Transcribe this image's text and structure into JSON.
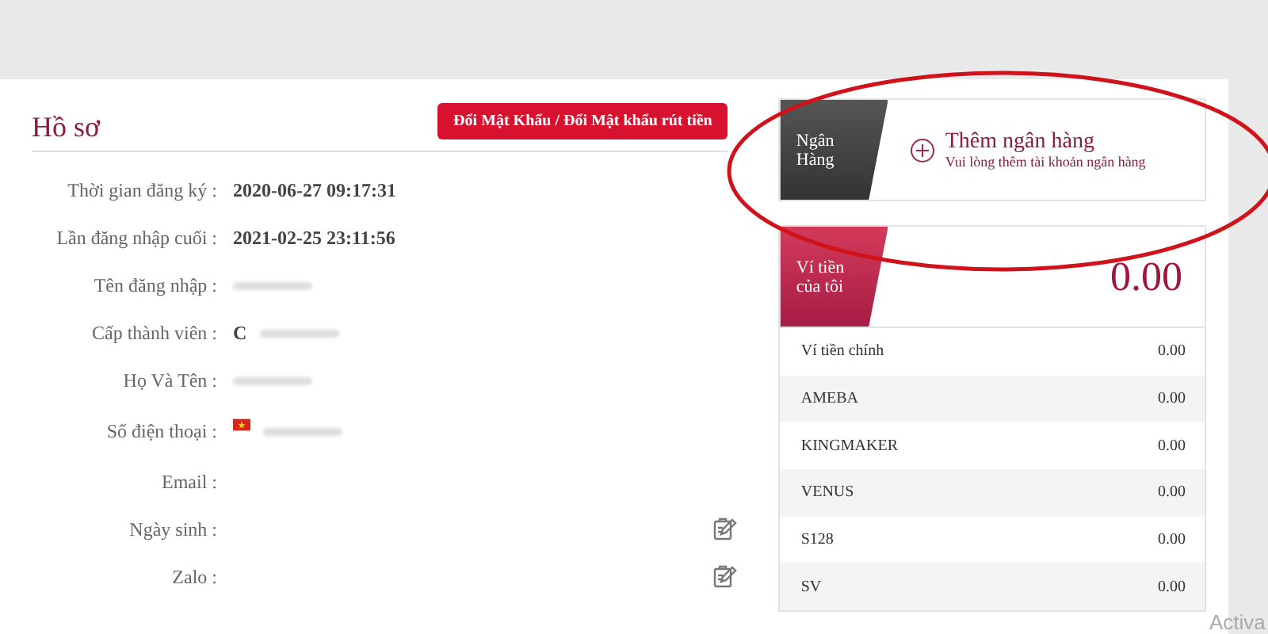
{
  "profile": {
    "title": "Hồ sơ",
    "change_password_button": "Đổi Mật Khẩu / Đổi Mật khẩu rút tiền",
    "fields": [
      {
        "label": "Thời gian đăng ký :",
        "value": "2020-06-27 09:17:31"
      },
      {
        "label": "Lần đăng nhập cuối :",
        "value": "2021-02-25 23:11:56"
      },
      {
        "label": "Tên đăng nhập :",
        "redacted": true
      },
      {
        "label": "Cấp thành viên :",
        "value": "C",
        "redacted": true
      },
      {
        "label": "Họ Và Tên :",
        "redacted": true
      },
      {
        "label": "Số điện thoại :",
        "redacted": true,
        "flag": true
      },
      {
        "label": "Email :"
      },
      {
        "label": "Ngày sinh :",
        "editable": true
      },
      {
        "label": "Zalo :",
        "editable": true
      }
    ]
  },
  "bank": {
    "tag": "Ngân Hàng",
    "add_title": "Thêm ngân hàng",
    "add_hint": "Vui lòng thêm tài khoản ngân hàng"
  },
  "wallet": {
    "tag": "Ví tiền của tôi",
    "total": "0.00",
    "rows": [
      {
        "name": "Ví tiền chính",
        "amount": "0.00"
      },
      {
        "name": "AMEBA",
        "amount": "0.00"
      },
      {
        "name": "KINGMAKER",
        "amount": "0.00"
      },
      {
        "name": "VENUS",
        "amount": "0.00"
      },
      {
        "name": "S128",
        "amount": "0.00"
      },
      {
        "name": "SV",
        "amount": "0.00"
      }
    ]
  },
  "annotation": {
    "kind": "ellipse",
    "color": "#d0131b"
  },
  "activation_notice": "Activa"
}
